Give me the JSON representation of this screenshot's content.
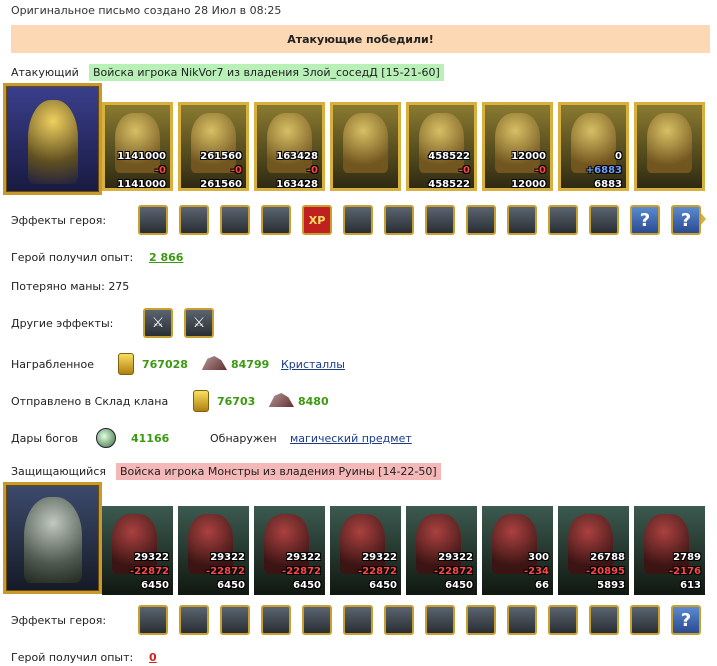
{
  "header": {
    "date_line": "Оригинальное письмо создано 28 Июл в 08:25"
  },
  "banner": {
    "text": "Атакующие победили!"
  },
  "attacker": {
    "label": "Атакующий",
    "army": "Войска игрока NikVor7 из владения Злой_соседД [15-21-60]",
    "units": [
      {
        "n1": "1141000",
        "n2": "-0",
        "n3": "1141000"
      },
      {
        "n1": "261560",
        "n2": "-0",
        "n3": "261560"
      },
      {
        "n1": "163428",
        "n2": "-0",
        "n3": "163428"
      },
      {
        "n1": "",
        "n2": "",
        "n3": ""
      },
      {
        "n1": "458522",
        "n2": "-0",
        "n3": "458522"
      },
      {
        "n1": "12000",
        "n2": "-0",
        "n3": "12000"
      },
      {
        "n1": "0",
        "n2": "+6883",
        "n3": "6883"
      },
      {
        "n1": "",
        "n2": "",
        "n3": ""
      }
    ],
    "effects_label": "Эффекты героя:",
    "exp_label": "Герой получил опыт:",
    "exp_value": "2 866",
    "mana_label": "Потеряно маны: 275",
    "other_effects_label": "Другие эффекты:",
    "reward_label": "Награбленное",
    "reward_gold": "767028",
    "reward_ore": "84799",
    "reward_link": "Кристаллы",
    "clan_label": "Отправлено в Склад клана",
    "clan_gold": "76703",
    "clan_ore": "8480",
    "gifts_label": "Дары богов",
    "gifts_value": "41166",
    "found_label": "Обнаружен",
    "found_link": "магический предмет",
    "effect_icons": [
      "siege-icon",
      "dice-icon",
      "shield-icon",
      "handshake-icon",
      "xp-icon",
      "xp-bonus-icon",
      "sword-icon",
      "handshake-gold-icon",
      "hand-magic-icon",
      "ring-icon",
      "web-icon",
      "armor-icon",
      "question-icon",
      "question-icon"
    ],
    "effect_q": "?",
    "effect_xp": "XP"
  },
  "defender": {
    "label": "Защищающийся",
    "army": "Войска игрока Монстры из владения Руины [14-22-50]",
    "units": [
      {
        "n1": "29322",
        "n2": "-22872",
        "n3": "6450"
      },
      {
        "n1": "29322",
        "n2": "-22872",
        "n3": "6450"
      },
      {
        "n1": "29322",
        "n2": "-22872",
        "n3": "6450"
      },
      {
        "n1": "29322",
        "n2": "-22872",
        "n3": "6450"
      },
      {
        "n1": "29322",
        "n2": "-22872",
        "n3": "6450"
      },
      {
        "n1": "300",
        "n2": "-234",
        "n3": "66"
      },
      {
        "n1": "26788",
        "n2": "-20895",
        "n3": "5893"
      },
      {
        "n1": "2789",
        "n2": "-2176",
        "n3": "613"
      }
    ],
    "effects_label": "Эффекты героя:",
    "exp_label": "Герой получил опыт:",
    "exp_value": "0",
    "effect_icons": [
      "bag-icon",
      "arrows-icon",
      "shield-icon",
      "dwarf-icon",
      "scroll-icon",
      "crossed-tools-icon",
      "fire-icon",
      "frost-icon",
      "ice-icon",
      "ring-icon",
      "wand-icon",
      "snowflake-icon",
      "crystal-icon",
      "question-icon"
    ]
  }
}
